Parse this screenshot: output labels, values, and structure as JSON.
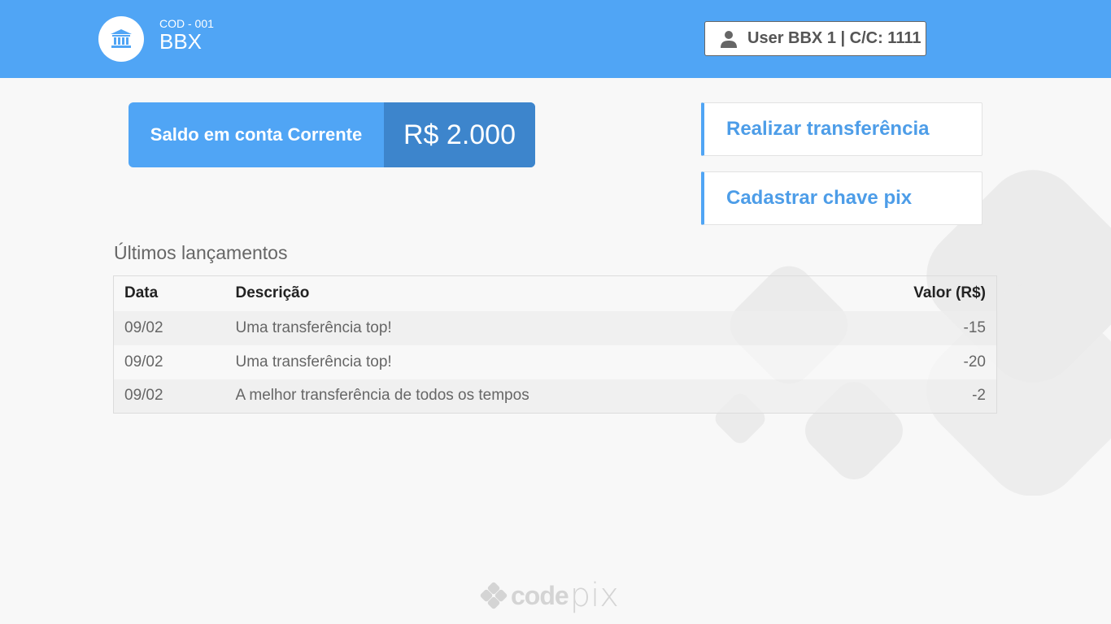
{
  "header": {
    "bank_code": "COD - 001",
    "bank_name": "BBX",
    "bank_icon": "bank-icon",
    "user_icon": "user-icon",
    "user_label": "User BBX 1 | C/C: 1111",
    "bar_color": "#50a5f5"
  },
  "balance": {
    "label": "Saldo em conta Corrente",
    "value": "R$ 2.000"
  },
  "actions": {
    "transfer": "Realizar transferência",
    "pix_key": "Cadastrar chave pix"
  },
  "transactions": {
    "title": "Últimos lançamentos",
    "columns": [
      "Data",
      "Descrição",
      "Valor (R$)"
    ],
    "rows": [
      {
        "date": "09/02",
        "description": "Uma transferência top!",
        "value": "-15"
      },
      {
        "date": "09/02",
        "description": "Uma transferência top!",
        "value": "-20"
      },
      {
        "date": "09/02",
        "description": "A melhor transferência de todos os tempos",
        "value": "-2"
      }
    ]
  },
  "footer": {
    "logo_code": "code",
    "logo_pix": "pix"
  },
  "colors": {
    "accent": "#50a5f5",
    "accent_dark": "#3d85cc"
  }
}
